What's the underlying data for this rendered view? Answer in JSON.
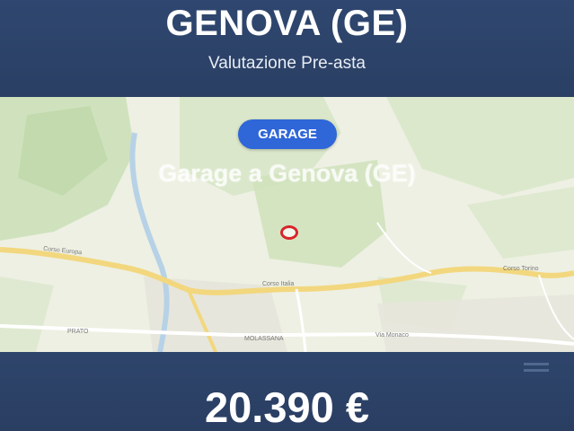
{
  "header": {
    "city": "GENOVA (GE)",
    "subtitle": "Valutazione Pre-asta"
  },
  "map": {
    "badge": "GARAGE",
    "title": "Garage a Genova (GE)",
    "labels": {
      "road_left": "Corso Europa",
      "road_center": "Corso Italia",
      "road_right": "Corso Torino",
      "area_left": "PRATO",
      "area_center": "MOLASSANA",
      "road_bottom": "Via Monaco"
    }
  },
  "footer": {
    "price": "20.390 €"
  },
  "colors": {
    "header_bg": "#2f4770",
    "badge_bg": "#2f66d8",
    "pin": "#d8262b",
    "map_bg": "#eef0e3"
  }
}
